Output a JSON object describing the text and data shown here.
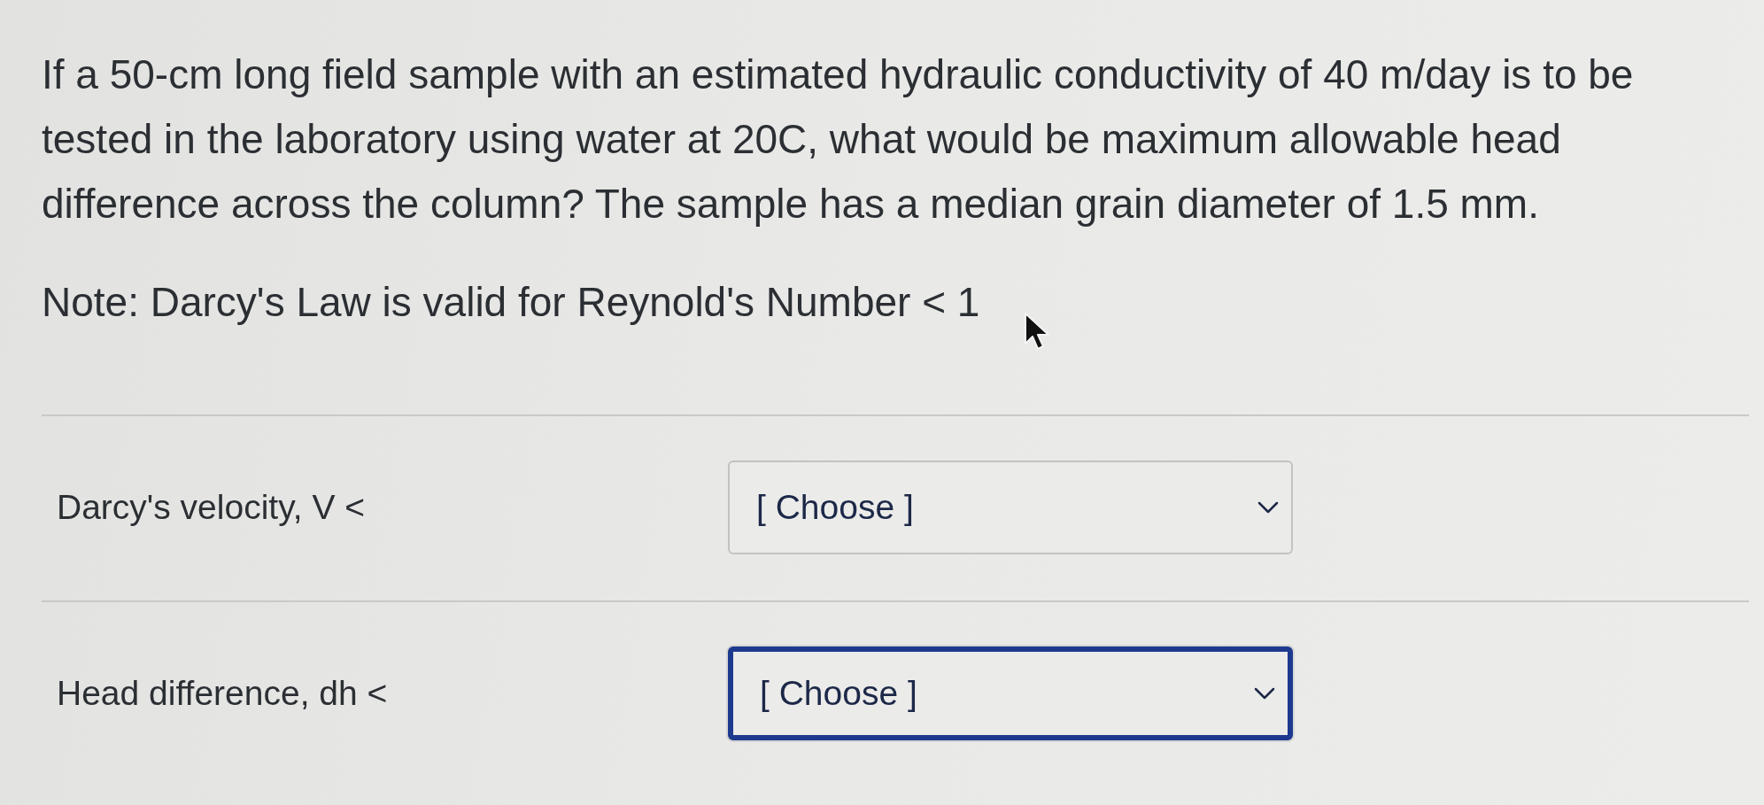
{
  "question": {
    "text": "If a 50-cm long field sample with an estimated hydraulic conductivity of 40 m/day is to be tested in the laboratory using water at 20C, what would be maximum allowable head difference across the column? The sample has a median grain diameter of 1.5 mm.",
    "note": "Note: Darcy's Law is valid for Reynold's Number < 1"
  },
  "answers": [
    {
      "label": "Darcy's velocity, V <",
      "select": {
        "value": "[ Choose ]",
        "focused": false
      }
    },
    {
      "label": "Head difference, dh <",
      "select": {
        "value": "[ Choose ]",
        "focused": true
      }
    }
  ]
}
